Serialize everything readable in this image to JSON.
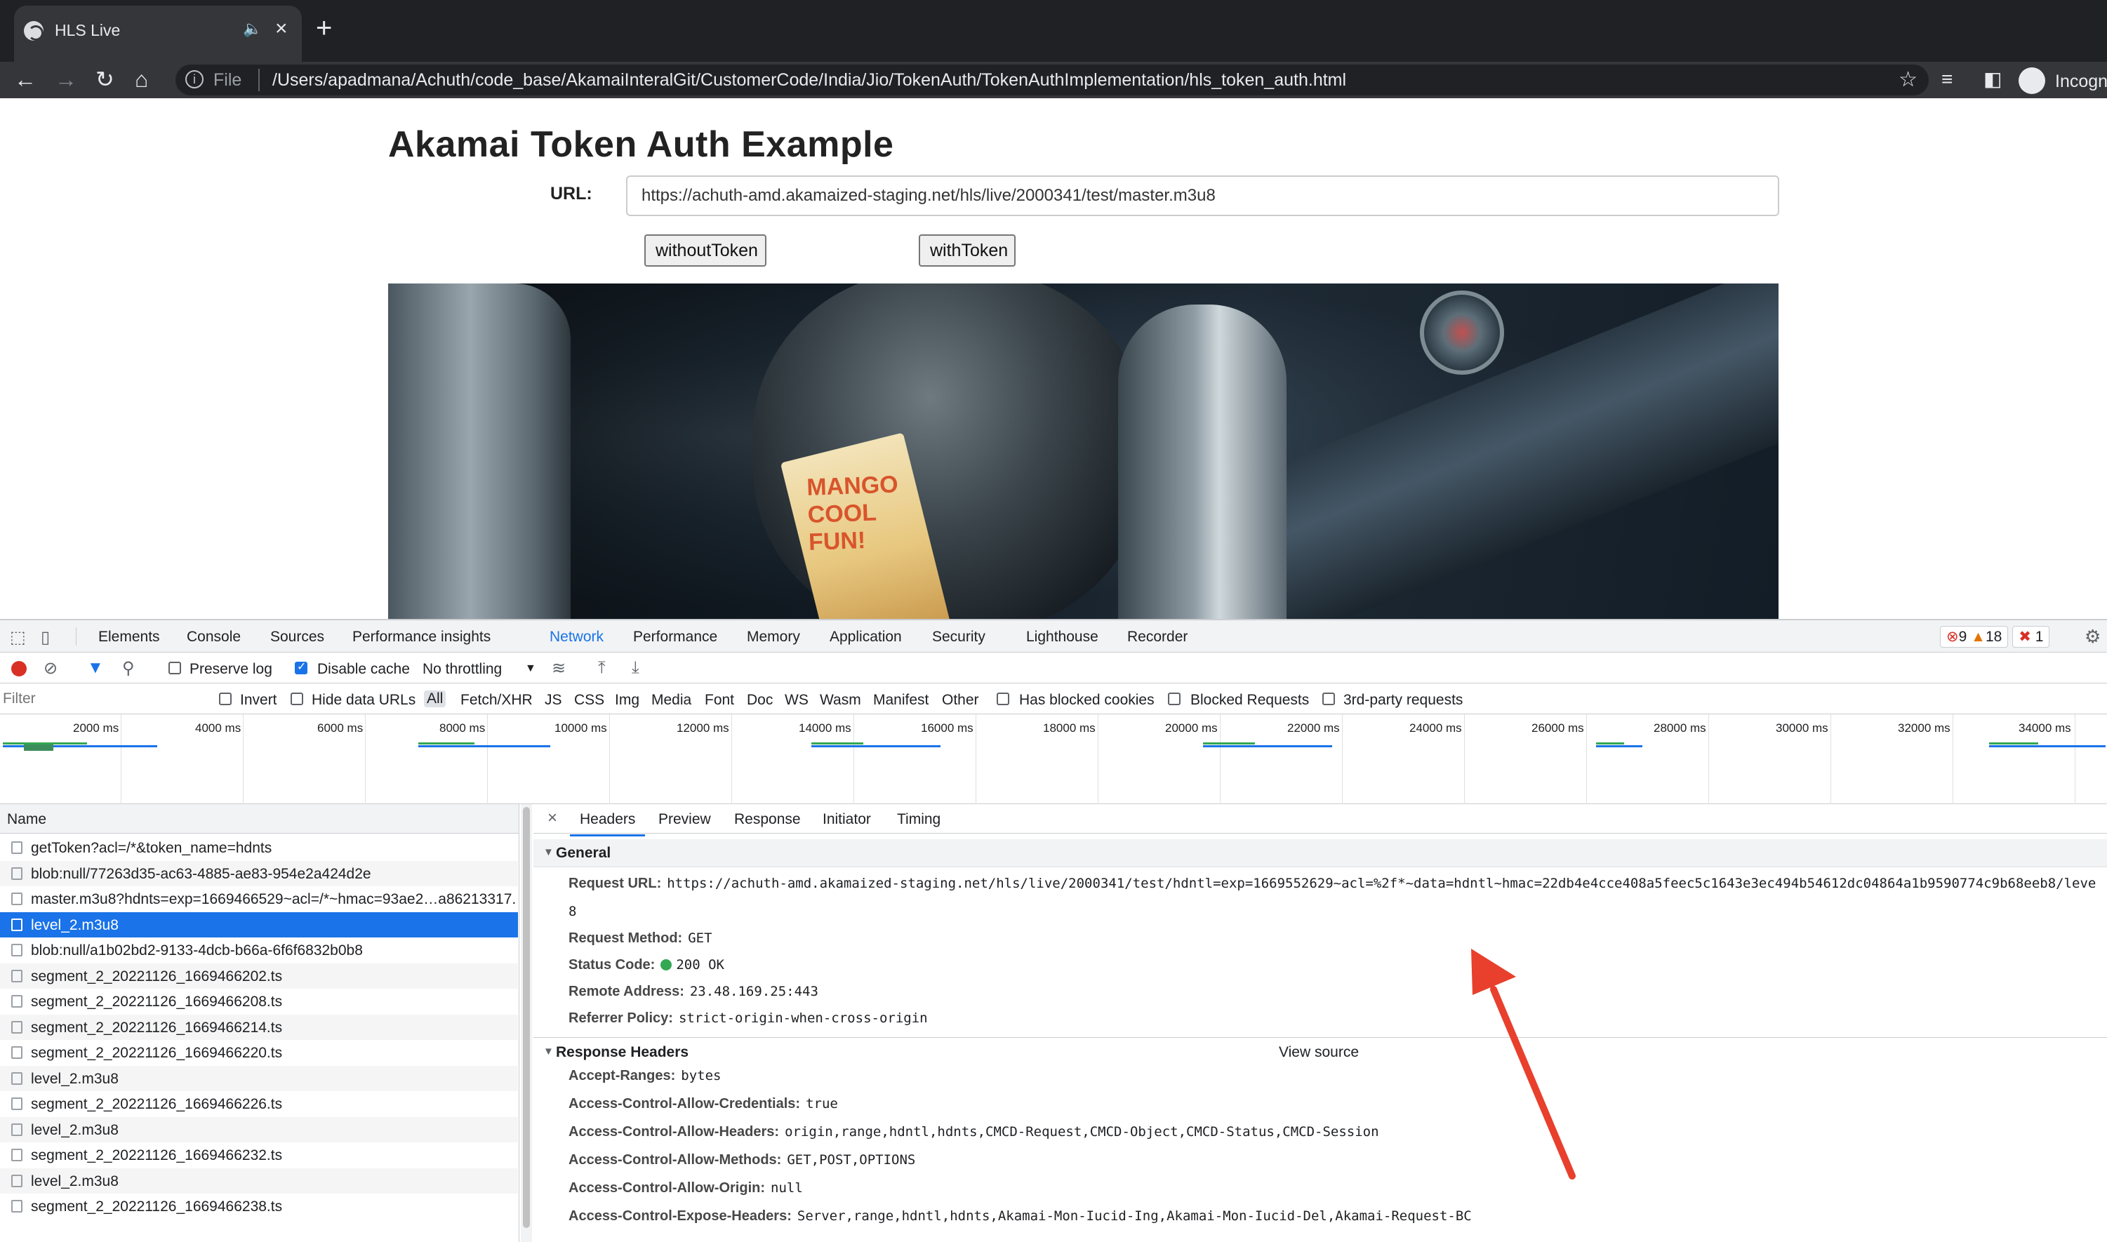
{
  "browser": {
    "tab_title": "HLS Live",
    "address_scheme": "File",
    "address_url": "/Users/apadmana/Achuth/code_base/AkamaiInteralGit/CustomerCode/India/Jio/TokenAuth/TokenAuthImplementation/hls_token_auth.html",
    "profile_label": "Incogn"
  },
  "page": {
    "title": "Akamai Token Auth Example",
    "url_label": "URL:",
    "url_value": "https://achuth-amd.akamaized-staging.net/hls/live/2000341/test/master.m3u8",
    "btn_without": "withoutToken",
    "btn_with": "withToken",
    "video_carton_text": "MANGO COOL FUN!"
  },
  "devtools": {
    "tabs": [
      "Elements",
      "Console",
      "Sources",
      "Performance insights",
      "Network",
      "Performance",
      "Memory",
      "Application",
      "Security",
      "Lighthouse",
      "Recorder"
    ],
    "counts": {
      "errors": "9",
      "warnings": "18",
      "issues": "1"
    },
    "toolbar": {
      "preserve_log": "Preserve log",
      "disable_cache": "Disable cache",
      "throttling": "No throttling"
    },
    "filter": {
      "placeholder": "Filter",
      "invert": "Invert",
      "hide_data_urls": "Hide data URLs",
      "types": [
        "All",
        "Fetch/XHR",
        "JS",
        "CSS",
        "Img",
        "Media",
        "Font",
        "Doc",
        "WS",
        "Wasm",
        "Manifest",
        "Other"
      ],
      "blocked_cookies": "Has blocked cookies",
      "blocked_requests": "Blocked Requests",
      "third_party": "3rd-party requests"
    },
    "overview_ticks": [
      "2000 ms",
      "4000 ms",
      "6000 ms",
      "8000 ms",
      "10000 ms",
      "12000 ms",
      "14000 ms",
      "16000 ms",
      "18000 ms",
      "20000 ms",
      "22000 ms",
      "24000 ms",
      "26000 ms",
      "28000 ms",
      "30000 ms",
      "32000 ms",
      "34000 ms"
    ],
    "requests_header": "Name",
    "requests": [
      "getToken?acl=/*&token_name=hdnts",
      "blob:null/77263d35-ac63-4885-ae83-954e2a424d2e",
      "master.m3u8?hdnts=exp=1669466529~acl=/*~hmac=93ae2…a86213317.",
      "level_2.m3u8",
      "blob:null/a1b02bd2-9133-4dcb-b66a-6f6f6832b0b8",
      "segment_2_20221126_1669466202.ts",
      "segment_2_20221126_1669466208.ts",
      "segment_2_20221126_1669466214.ts",
      "segment_2_20221126_1669466220.ts",
      "level_2.m3u8",
      "segment_2_20221126_1669466226.ts",
      "level_2.m3u8",
      "segment_2_20221126_1669466232.ts",
      "level_2.m3u8",
      "segment_2_20221126_1669466238.ts"
    ],
    "detail_tabs": [
      "Headers",
      "Preview",
      "Response",
      "Initiator",
      "Timing"
    ],
    "general": {
      "title": "General",
      "request_url_key": "Request URL:",
      "request_url_value": "https://achuth-amd.akamaized-staging.net/hls/live/2000341/test/hdntl=exp=1669552629~acl=%2f*~data=hdntl~hmac=22db4e4cce408a5feec5c1643e3ec494b54612dc04864a1b9590774c9b68eeb8/leve",
      "request_url_wrap": "8",
      "method_key": "Request Method:",
      "method_value": "GET",
      "status_key": "Status Code:",
      "status_value": "200 OK",
      "remote_key": "Remote Address:",
      "remote_value": "23.48.169.25:443",
      "referrer_key": "Referrer Policy:",
      "referrer_value": "strict-origin-when-cross-origin"
    },
    "response_headers": {
      "title": "Response Headers",
      "view_source": "View source",
      "items": [
        {
          "k": "Accept-Ranges:",
          "v": "bytes"
        },
        {
          "k": "Access-Control-Allow-Credentials:",
          "v": "true"
        },
        {
          "k": "Access-Control-Allow-Headers:",
          "v": "origin,range,hdntl,hdnts,CMCD-Request,CMCD-Object,CMCD-Status,CMCD-Session"
        },
        {
          "k": "Access-Control-Allow-Methods:",
          "v": "GET,POST,OPTIONS"
        },
        {
          "k": "Access-Control-Allow-Origin:",
          "v": "null"
        },
        {
          "k": "Access-Control-Expose-Headers:",
          "v": "Server,range,hdntl,hdnts,Akamai-Mon-Iucid-Ing,Akamai-Mon-Iucid-Del,Akamai-Request-BC"
        }
      ]
    }
  },
  "colors": {
    "annotation_arrow": "#e8402c",
    "accent": "#1a73e8"
  }
}
